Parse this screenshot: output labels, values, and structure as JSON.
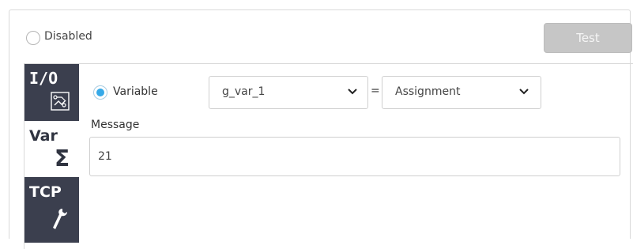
{
  "header": {
    "disabled_label": "Disabled",
    "disabled_checked": false,
    "test_button": "Test",
    "test_button_enabled": false
  },
  "tabs": [
    {
      "label": "I/O",
      "icon": "circuit-icon",
      "active": false
    },
    {
      "label": "Var",
      "icon": "sigma-icon",
      "active": true
    },
    {
      "label": "TCP",
      "icon": "wrench-icon",
      "active": false
    }
  ],
  "variable": {
    "label": "Variable",
    "checked": true,
    "selected_variable": "g_var_1",
    "equals": "=",
    "operation": "Assignment"
  },
  "message": {
    "label": "Message",
    "value": "21"
  },
  "colors": {
    "tab_dark": "#3b3f4e",
    "radio_accent": "#35a9e8",
    "button_disabled": "#c6c6c6"
  }
}
